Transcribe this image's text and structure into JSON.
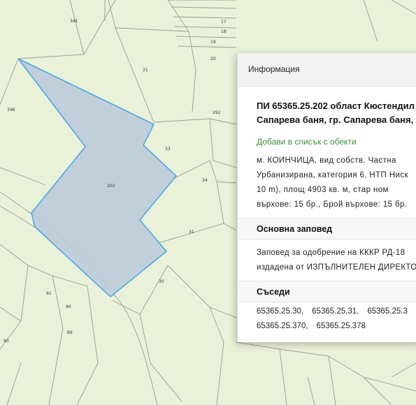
{
  "map": {
    "parcel_labels": [
      "341",
      "17",
      "18",
      "19",
      "20",
      "21",
      "346",
      "292",
      "33",
      "202",
      "34",
      "31",
      "30",
      "91",
      "90",
      "89",
      "90"
    ],
    "selected_parcel": "202",
    "colors": {
      "background": "#e9f2d8",
      "parcel_line": "#9a9a8a",
      "selection_fill": "#bccbdb",
      "selection_stroke": "#4aa8e6"
    }
  },
  "info_panel": {
    "header": "Информация",
    "title_line1": "ПИ 65365.25.202 област Кюстендил",
    "title_line2": "Сапарева баня, гр. Сапарева баня, м",
    "add_to_list": "Добави в списък с обекти",
    "description": [
      "м. КОИНЧИЦА, вид собств. Частна",
      "Урбанизирана, категория 6, НТП Ниск",
      "10 m), площ 4903 кв. м, стар ном",
      "върхове: 15 бр., Брой върхове: 15 бр."
    ],
    "order_heading": "Основна заповед",
    "order_text": [
      "Заповед за одобрение на КККР РД-18",
      "издадена от ИЗПЪЛНИТЕЛЕН ДИРЕКТО"
    ],
    "neighbors_heading": "Съседи",
    "neighbors": [
      "65365.25.30,",
      "65365.25.31,",
      "65365.25.3",
      "65365.25.370,",
      "65365.25.378"
    ]
  }
}
